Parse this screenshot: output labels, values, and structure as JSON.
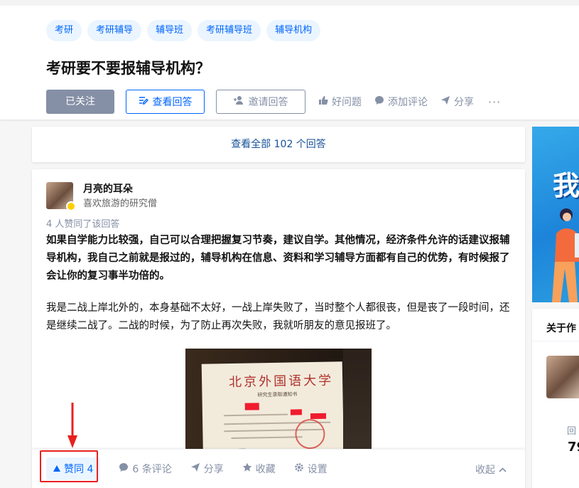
{
  "question": {
    "tags": [
      "考研",
      "考研辅导",
      "辅导班",
      "考研辅导班",
      "辅导机构"
    ],
    "title": "考研要不要报辅导机构？",
    "actions": {
      "followed": "已关注",
      "view_answer": "查看回答",
      "invite": "邀请回答",
      "good_question": "好问题",
      "add_comment": "添加评论",
      "share": "分享",
      "more": "···"
    }
  },
  "view_all": "查看全部 102 个回答",
  "answer": {
    "author_name": "月亮的耳朵",
    "author_bio": "喜欢旅游的研究僧",
    "votes_line": "4 人赞同了该回答",
    "paragraph1": "如果自学能力比较强，自己可以合理把握复习节奏，建议自学。其他情况，经济条件允许的话建议报辅导机构，我自己之前就是报过的，辅导机构在信息、资料和学习辅导方面都有自己的优势，有时候报了会让你的复习事半功倍的。",
    "paragraph2": "我是二战上岸北外的，本身基础不太好，一战上岸失败了，当时整个人都很丧，但是丧了一段时间，还是继续二战了。二战的时候，为了防止再次失败，我就听朋友的意见报班了。",
    "photo": {
      "doc_title": "北京外国语大学",
      "doc_subtitle": "研究生录取通知书"
    },
    "bar": {
      "upvote": "赞同 4",
      "comments": "6 条评论",
      "share": "分享",
      "favorite": "收藏",
      "settings": "设置",
      "collapse": "收起"
    }
  },
  "sidebar": {
    "banner_char": "我",
    "about_title": "关于作",
    "stat_label": "回",
    "stat_value": "79"
  },
  "colors": {
    "brand_blue": "#0066ff",
    "link_blue": "#175199",
    "muted": "#8590a6",
    "highlight_red": "#e8201e"
  }
}
